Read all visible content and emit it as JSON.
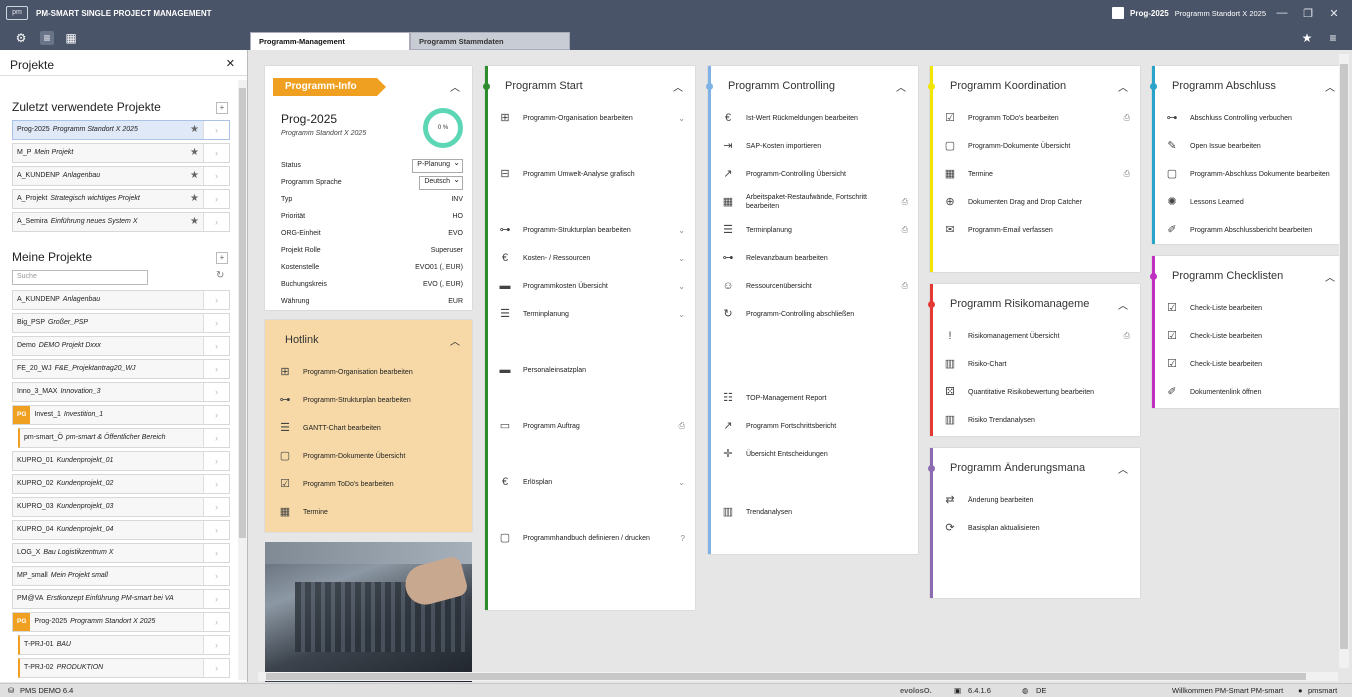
{
  "app": {
    "title": "PM-SMART SINGLE PROJECT MANAGEMENT",
    "logo_text": "pm",
    "project_code": "Prog-2025",
    "project_name": "Programm Standort X 2025"
  },
  "tabs": [
    "Programm-Management",
    "Programm Stammdaten"
  ],
  "sidebar": {
    "title": "Projekte",
    "recent_title": "Zuletzt verwendete Projekte",
    "recent": [
      {
        "code": "Prog-2025",
        "name": "Programm Standort X 2025"
      },
      {
        "code": "M_P",
        "name": "Mein Projekt"
      },
      {
        "code": "A_KUNDENP",
        "name": "Anlagenbau"
      },
      {
        "code": "A_Projekt",
        "name": "Strategisch wichtiges Projekt"
      },
      {
        "code": "A_Semira",
        "name": "Einführung neues System X"
      }
    ],
    "my_title": "Meine Projekte",
    "search_placeholder": "Suche",
    "my": [
      {
        "code": "A_KUNDENP",
        "name": "Anlagenbau"
      },
      {
        "code": "Big_PSP",
        "name": "Großer_PSP"
      },
      {
        "code": "Demo",
        "name": "DEMO Projekt Dxxx"
      },
      {
        "code": "FE_20_WJ",
        "name": "F&E_Projektantrag20_WJ"
      },
      {
        "code": "Inno_3_MAX",
        "name": "Innovation_3"
      },
      {
        "code": "Invest_1",
        "name": "Investition_1",
        "badge": "PG"
      },
      {
        "code": "pm-smart_Ö",
        "name": "pm-smart & Öffentlicher Bereich",
        "child": true
      },
      {
        "code": "KUPRO_01",
        "name": "Kundenprojekt_01"
      },
      {
        "code": "KUPRO_02",
        "name": "Kundenprojekt_02"
      },
      {
        "code": "KUPRO_03",
        "name": "Kundenprojekt_03"
      },
      {
        "code": "KUPRO_04",
        "name": "Kundenprojekt_04"
      },
      {
        "code": "LOG_X",
        "name": "Bau Logistikzentrum X"
      },
      {
        "code": "MP_small",
        "name": "Mein Projekt small"
      },
      {
        "code": "PM@VA",
        "name": "Erstkonzept Einführung PM-smart bei VA"
      },
      {
        "code": "Prog-2025",
        "name": "Programm Standort X 2025",
        "badge": "PG"
      },
      {
        "code": "T-PRJ-01",
        "name": "BAU",
        "child": true
      },
      {
        "code": "T-PRJ-02",
        "name": "PRODUKTION",
        "child": true
      }
    ]
  },
  "program_info": {
    "tag": "Programm-Info",
    "code": "Prog-2025",
    "name": "Programm Standort X 2025",
    "progress": "0 %",
    "fields": [
      {
        "k": "Status",
        "v": "P-Planung",
        "select": true
      },
      {
        "k": "Programm Sprache",
        "v": "Deutsch",
        "select": true
      },
      {
        "k": "Typ",
        "v": "INV"
      },
      {
        "k": "Priorität",
        "v": "HO"
      },
      {
        "k": "ORG-Einheit",
        "v": "EVO"
      },
      {
        "k": "Projekt Rolle",
        "v": "Superuser"
      },
      {
        "k": "Kostenstelle",
        "v": "EVO01 (, EUR)"
      },
      {
        "k": "Buchungskreis",
        "v": "EVO (, EUR)"
      },
      {
        "k": "Währung",
        "v": "EUR"
      }
    ]
  },
  "hotlink": {
    "title": "Hotlink",
    "items": [
      {
        "label": "Programm-Organisation bearbeiten",
        "icon": "org-icon"
      },
      {
        "label": "Programm-Strukturplan bearbeiten",
        "icon": "tree-icon"
      },
      {
        "label": "GANTT-Chart bearbeiten",
        "icon": "gantt-icon"
      },
      {
        "label": "Programm-Dokumente Übersicht",
        "icon": "document-icon"
      },
      {
        "label": "Programm ToDo's bearbeiten",
        "icon": "todo-icon"
      },
      {
        "label": "Termine",
        "icon": "calendar-icon"
      }
    ]
  },
  "panels": {
    "start": {
      "title": "Programm Start",
      "color": "#2e8b2e",
      "items": [
        {
          "label": "Programm-Organisation bearbeiten",
          "icon": "org-icon",
          "end": "⌄"
        },
        {
          "label": "Programm Umwelt-Analyse grafisch",
          "icon": "network-icon"
        },
        {
          "label": "Programm-Strukturplan bearbeiten",
          "icon": "tree-icon",
          "end": "⌄"
        },
        {
          "label": "Kosten- / Ressourcen",
          "icon": "euro-icon",
          "end": "⌄"
        },
        {
          "label": "Programmkosten Übersicht",
          "icon": "bars-icon",
          "end": "⌄"
        },
        {
          "label": "Terminplanung",
          "icon": "list-icon",
          "end": "⌄"
        },
        {
          "label": "Personaleinsatzplan",
          "icon": "bars-icon"
        },
        {
          "label": "Programm Auftrag",
          "icon": "folder-icon",
          "end": "⎙"
        },
        {
          "label": "Erlösplan",
          "icon": "euro-icon",
          "end": "⌄"
        },
        {
          "label": "Programmhandbuch definieren / drucken",
          "icon": "document-icon",
          "end": "?"
        }
      ]
    },
    "controlling": {
      "title": "Programm Controlling",
      "color": "#7fb2e5",
      "items": [
        {
          "label": "Ist-Wert Rückmeldungen bearbeiten",
          "icon": "euro-icon"
        },
        {
          "label": "SAP-Kosten importieren",
          "icon": "import-icon"
        },
        {
          "label": "Programm-Controlling Übersicht",
          "icon": "chart-icon"
        },
        {
          "label": "Arbeitspaket-Restaufwände, Fortschritt bearbeiten",
          "icon": "table-icon",
          "end": "⎙"
        },
        {
          "label": "Terminplanung",
          "icon": "list-icon",
          "end": "⎙"
        },
        {
          "label": "Relevanzbaum bearbeiten",
          "icon": "tree-icon"
        },
        {
          "label": "Ressourcenübersicht",
          "icon": "people-icon",
          "end": "⎙"
        },
        {
          "label": "Programm-Controlling abschließen",
          "icon": "cycle-icon"
        },
        {
          "label": "TOP-Management Report",
          "icon": "report-icon"
        },
        {
          "label": "Programm Fortschrittsbericht",
          "icon": "chart-icon"
        },
        {
          "label": "Übersicht Entscheidungen",
          "icon": "decision-icon"
        },
        {
          "label": "Trendanalysen",
          "icon": "trend-icon"
        }
      ]
    },
    "koordination": {
      "title": "Programm Koordination",
      "color": "#f2e600",
      "items": [
        {
          "label": "Programm ToDo's bearbeiten",
          "icon": "todo-icon",
          "end": "⎙"
        },
        {
          "label": "Programm-Dokumente Übersicht",
          "icon": "document-icon"
        },
        {
          "label": "Termine",
          "icon": "calendar-icon",
          "end": "⎙"
        },
        {
          "label": "Dokumenten Drag and Drop Catcher",
          "icon": "add-doc-icon"
        },
        {
          "label": "Programm-Email verfassen",
          "icon": "mail-icon"
        }
      ]
    },
    "risiko": {
      "title": "Programm Risikomanageme",
      "color": "#e53935",
      "items": [
        {
          "label": "Risikomanagement Übersicht",
          "icon": "alert-icon",
          "end": "⎙"
        },
        {
          "label": "Risiko-Chart",
          "icon": "trend-icon"
        },
        {
          "label": "Quantitative Risikobewertung bearbeiten",
          "icon": "dice-icon"
        },
        {
          "label": "Risiko Trendanalysen",
          "icon": "trend-icon"
        }
      ]
    },
    "aenderung": {
      "title": "Programm Änderungsmana",
      "color": "#8c6bb1",
      "items": [
        {
          "label": "Änderung bearbeiten",
          "icon": "change-icon"
        },
        {
          "label": "Basisplan aktualisieren",
          "icon": "refresh-icon"
        }
      ]
    },
    "abschluss": {
      "title": "Programm Abschluss",
      "color": "#2aa3c9",
      "items": [
        {
          "label": "Abschluss Controlling verbuchen",
          "icon": "tree-check-icon"
        },
        {
          "label": "Open Issue bearbeiten",
          "icon": "pencil-icon"
        },
        {
          "label": "Programm-Abschluss Dokumente bearbeiten",
          "icon": "document-icon"
        },
        {
          "label": "Lessons Learned",
          "icon": "lessons-icon"
        },
        {
          "label": "Programm Abschlussbericht bearbeiten",
          "icon": "report-edit-icon"
        }
      ]
    },
    "checklisten": {
      "title": "Programm Checklisten",
      "color": "#c02fc0",
      "items": [
        {
          "label": "Check-Liste bearbeiten",
          "icon": "checklist-icon"
        },
        {
          "label": "Check-Liste bearbeiten",
          "icon": "checklist-icon"
        },
        {
          "label": "Check-Liste bearbeiten",
          "icon": "checklist-icon"
        },
        {
          "label": "Dokumentenlink öffnen",
          "icon": "report-edit-icon"
        }
      ]
    }
  },
  "statusbar": {
    "db": "PMS DEMO 6.4",
    "brand": "evolosO.",
    "version": "6.4.1.6",
    "lang": "DE",
    "welcome": "Willkommen PM-Smart PM-smart",
    "user": "pmsmart"
  }
}
